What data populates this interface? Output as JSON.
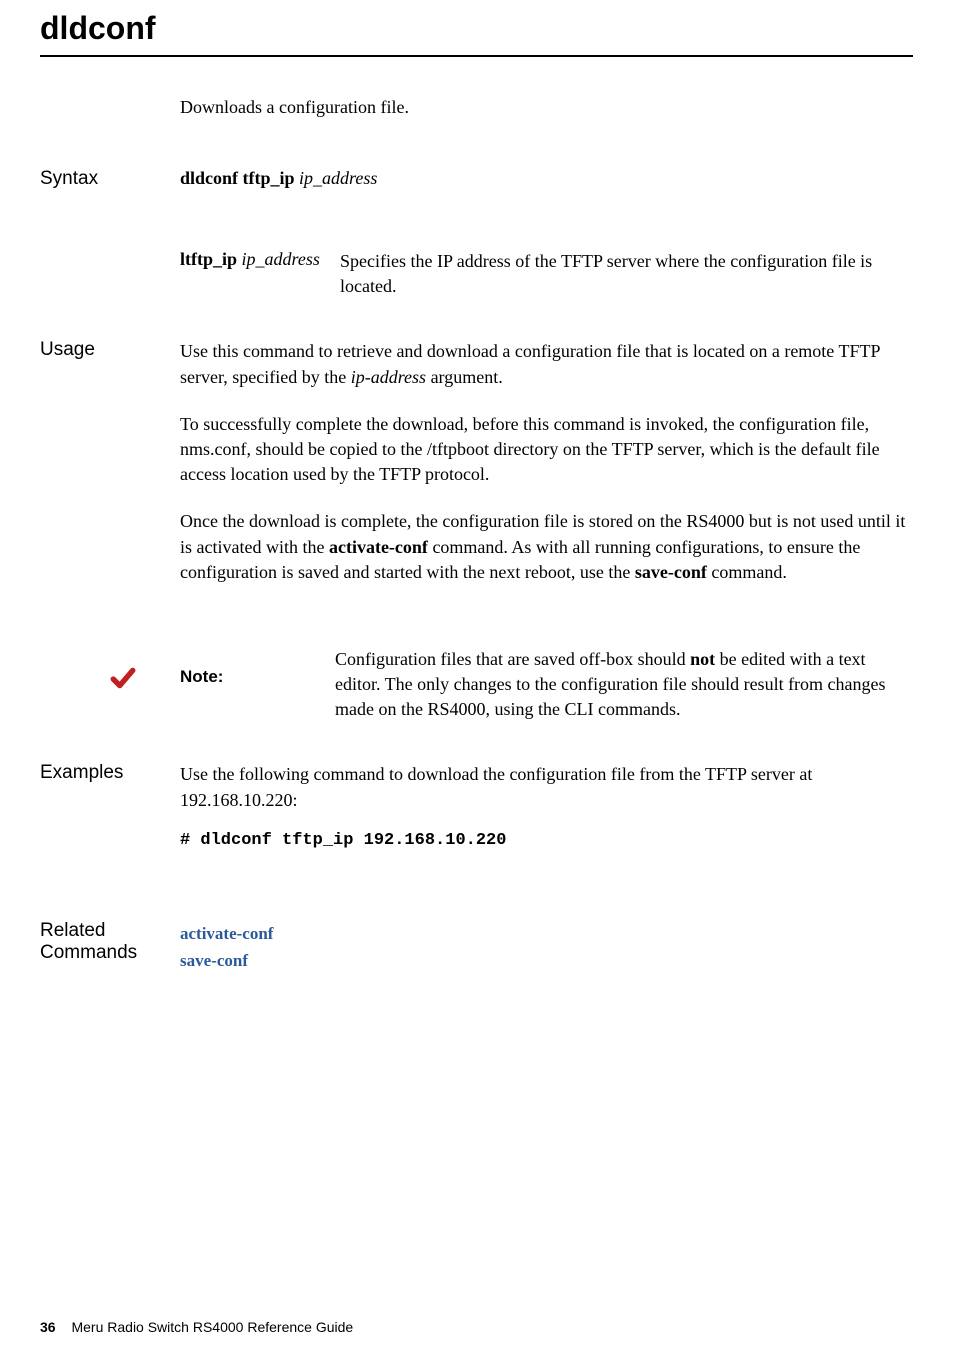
{
  "title": "dldconf",
  "intro": "Downloads a configuration file.",
  "syntax": {
    "label": "Syntax",
    "cmd_bold": "dldconf tftp_ip",
    "cmd_italic": "ip_address",
    "param_bold": "ltftp_ip",
    "param_italic": "ip_address",
    "param_desc": "Specifies the IP address of the TFTP server where the configuration file is located."
  },
  "usage": {
    "label": "Usage",
    "p1a": "Use this command to retrieve and download a configuration file that is located on a remote TFTP server, specified by the ",
    "p1i": "ip-address",
    "p1b": " argument.",
    "p2": "To successfully complete the download, before this command is invoked, the configuration file, nms.conf, should be copied to the /tftpboot directory on the TFTP server, which is the default file access location used by the TFTP protocol.",
    "p3a": "Once the download is complete, the configuration file is stored on the RS4000 but is not used until it is activated with the ",
    "p3b1": "activate-conf",
    "p3b": " command. As with all running configurations, to ensure the configuration is saved and started with the next reboot, use the ",
    "p3b2": "save-conf",
    "p3c": " command."
  },
  "note": {
    "label": "Note:",
    "t1": "Configuration files that are saved off-box should ",
    "tb": "not",
    "t2": " be edited with a text editor. The only changes to the configuration file should result from changes made on the RS4000, using the CLI commands."
  },
  "examples": {
    "label": "Examples",
    "intro": "Use the following command to download the configuration file from the TFTP server at 192.168.10.220:",
    "code": "# dldconf tftp_ip 192.168.10.220"
  },
  "related": {
    "label": "Related Commands",
    "link1": "activate-conf",
    "link2": "save-conf"
  },
  "footer": {
    "page": "36",
    "text": "Meru Radio Switch RS4000 Reference Guide"
  }
}
